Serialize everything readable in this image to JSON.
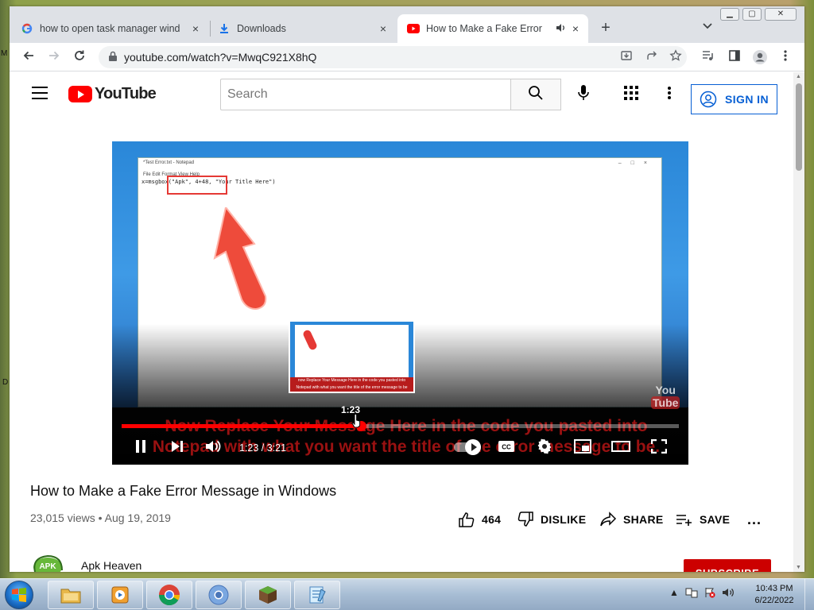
{
  "tabs": [
    {
      "label": "how to open task manager windo",
      "icon": "google-icon",
      "close": "×"
    },
    {
      "label": "Downloads",
      "icon": "download-icon",
      "close": "×"
    },
    {
      "label": "How to Make a Fake Error M",
      "icon": "youtube-icon",
      "close": "×",
      "audio": "speaker-icon"
    }
  ],
  "new_tab": "+",
  "address": {
    "url": "youtube.com/watch?v=MwqC921X8hQ"
  },
  "youtube": {
    "logo_text": "YouTube",
    "search_placeholder": "Search",
    "sign_in": "SIGN IN"
  },
  "video": {
    "notepad_title": "*Test Error.txt - Notepad",
    "notepad_menu": "File  Edit  Format  View  Help",
    "notepad_code": "x=msgbox(\"Apk\", 4+48, \"Your Title Here\")",
    "caption_line1": "Now Replace Your Message Here in the code you pasted into",
    "caption_line2": "Notepad with what you want the title of the error message to be.",
    "preview_caption1": "now Replace Your Message Here in the code you pasted into",
    "preview_caption2": "Notepad with what you want the title of the error message to be",
    "hover_time": "1:23",
    "time_display": "1:23 / 3:21",
    "progress": 0.43,
    "watermark1": "You",
    "watermark2": "Tube"
  },
  "meta": {
    "title": "How to Make a Fake Error Message in Windows",
    "views": "23,015 views • Aug 19, 2019",
    "likes": "464",
    "dislike": "DISLIKE",
    "share": "SHARE",
    "save": "SAVE",
    "more": "..."
  },
  "channel": {
    "name": "Apk Heaven",
    "avatar_text": "APK",
    "subscribe": "SUBSCRIBE"
  },
  "taskbar": {
    "time": "10:43 PM",
    "date": "6/22/2022",
    "apps": [
      "file-explorer-icon",
      "media-player-icon",
      "chrome-icon",
      "chrome-alt-icon",
      "minecraft-icon",
      "notepad-icon"
    ]
  },
  "desktop_fragments": {
    "left_top": "M",
    "left_mid": "D"
  },
  "colors": {
    "youtube_red": "#ff0000",
    "link_blue": "#065fd4",
    "subscribe_red": "#cc0000"
  }
}
